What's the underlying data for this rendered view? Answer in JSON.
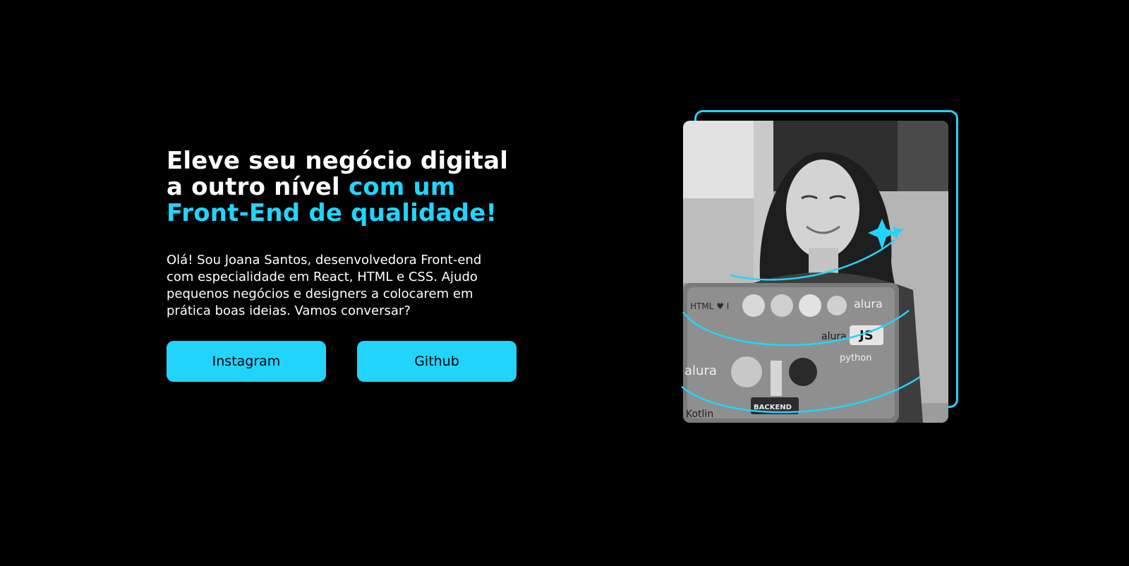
{
  "hero": {
    "headline_part1": "Eleve seu negócio digital a outro nível ",
    "headline_accent": "com um Front-End de qualidade!",
    "intro": "Olá! Sou Joana Santos, desenvolvedora Front-end com especialidade em React, HTML e CSS. Ajudo pequenos negócios e designers a colocarem em prática boas ideias. Vamos conversar?"
  },
  "buttons": {
    "instagram_label": "Instagram",
    "github_label": "Github"
  },
  "colors": {
    "background": "#000000",
    "accent": "#22d4fd",
    "text": "#ffffff"
  },
  "photo": {
    "sticker_texts": [
      "HTML ♥ I",
      "alura",
      "JS",
      "alura",
      "python",
      "alura",
      "BACKEND",
      "Kotlin"
    ]
  }
}
